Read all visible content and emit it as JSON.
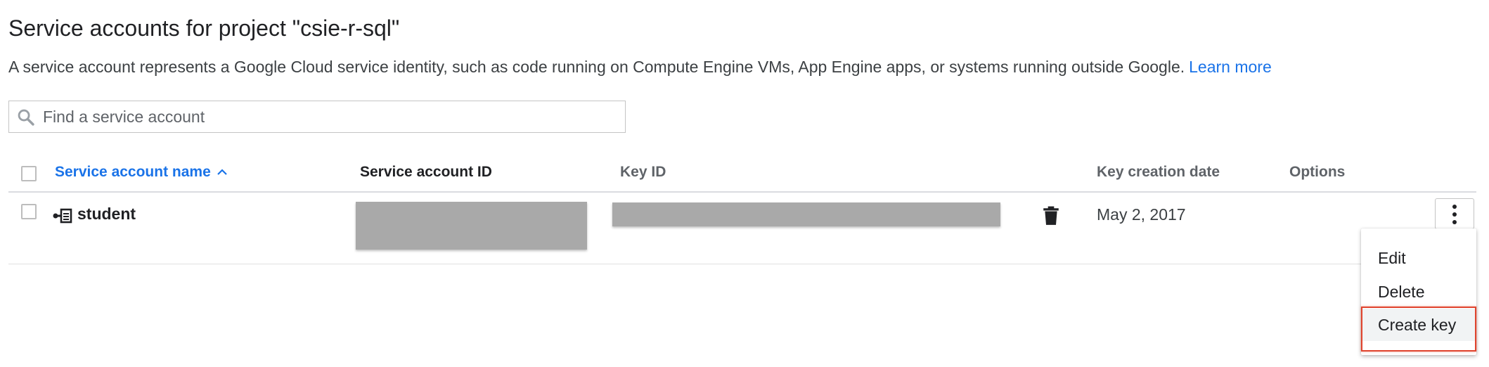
{
  "header": {
    "title": "Service accounts for project \"csie-r-sql\"",
    "description": "A service account represents a Google Cloud service identity, such as code running on Compute Engine VMs, App Engine apps, or systems running outside Google.",
    "learn_more": "Learn more"
  },
  "search": {
    "placeholder": "Find a service account",
    "value": "",
    "icon": "search-icon"
  },
  "table": {
    "columns": [
      {
        "label": "Service account name",
        "sorted": "ascending"
      },
      {
        "label": "Service account ID"
      },
      {
        "label": "Key ID"
      },
      {
        "label": "Key creation date"
      },
      {
        "label": "Options"
      }
    ],
    "rows": [
      {
        "name": "student",
        "icon": "service-account-icon",
        "service_account_id": "",
        "key_id": "",
        "key_creation_date": "May 2, 2017"
      }
    ]
  },
  "options_menu": {
    "items": [
      {
        "label": "Edit"
      },
      {
        "label": "Delete"
      },
      {
        "label": "Create key",
        "highlighted": true
      }
    ]
  },
  "colors": {
    "link": "#1a73e8",
    "highlight_border": "#e0442e",
    "redaction": "#a9a9a9"
  }
}
